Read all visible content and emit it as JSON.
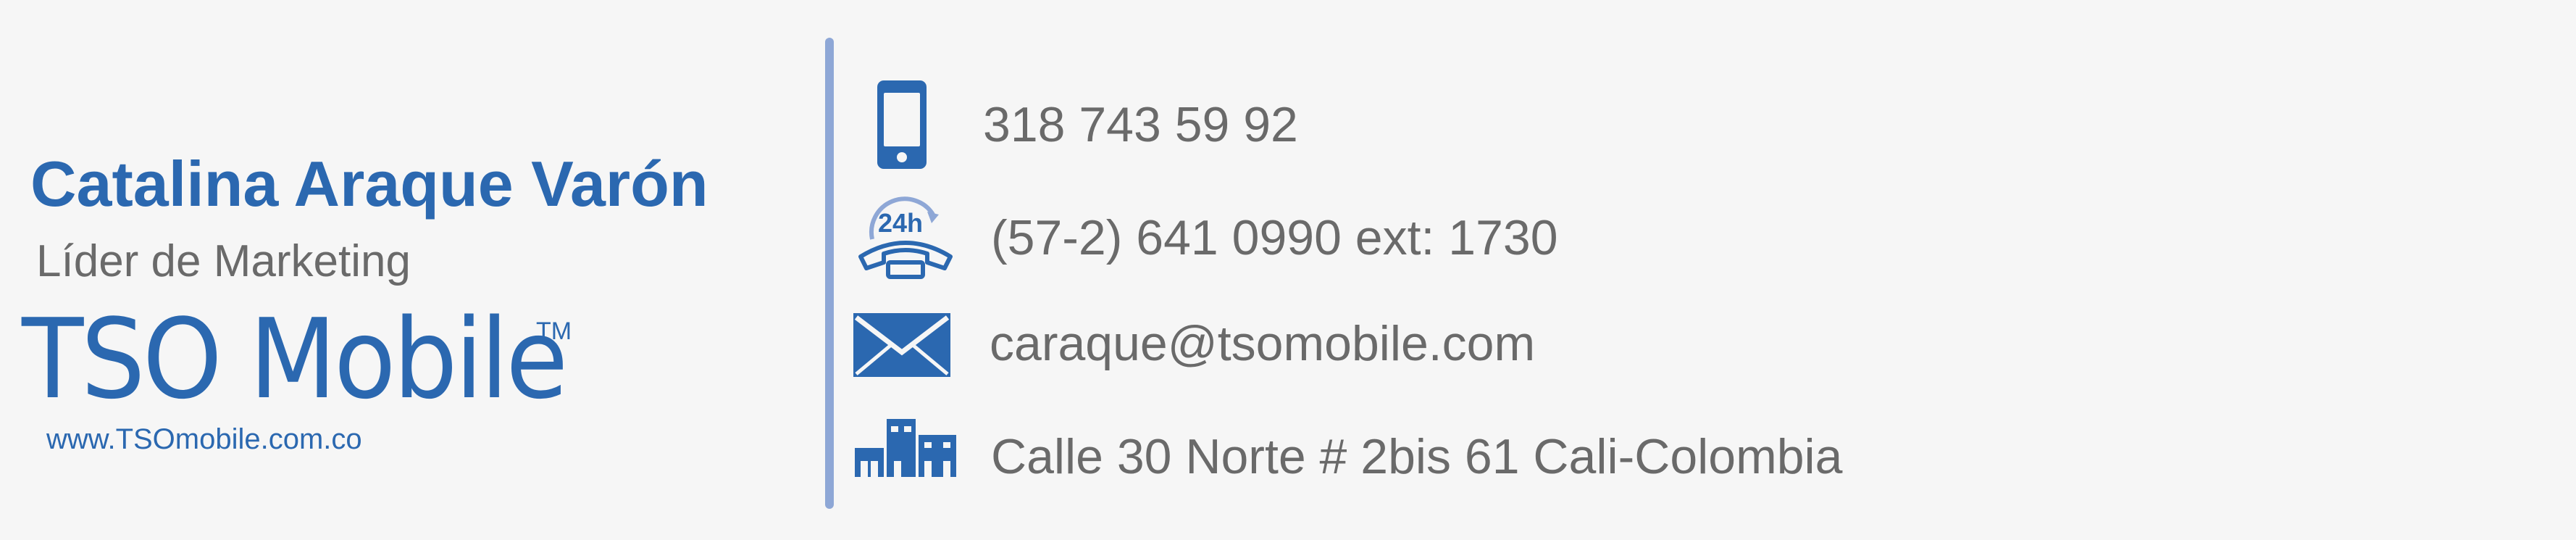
{
  "signature": {
    "name": "Catalina Araque Varón",
    "role": "Líder de Marketing",
    "company": {
      "logo_text": "TSO Mobile",
      "trademark": "TM",
      "website": "www.TSOmobile.com.co"
    }
  },
  "contact": {
    "mobile": {
      "icon": "smartphone-icon",
      "value": "318 743 59 92"
    },
    "phone": {
      "icon": "phone-24h-icon",
      "badge": "24h",
      "value": "(57-2) 641 0990 ext: 1730"
    },
    "email": {
      "icon": "envelope-icon",
      "value": "caraque@tsomobile.com"
    },
    "address": {
      "icon": "buildings-icon",
      "value": "Calle 30 Norte # 2bis 61 Cali-Colombia"
    }
  },
  "colors": {
    "brand_blue": "#2b68b0",
    "text_gray": "#6a6a6a",
    "divider": "#8ea7d6",
    "background": "#f6f6f6"
  }
}
